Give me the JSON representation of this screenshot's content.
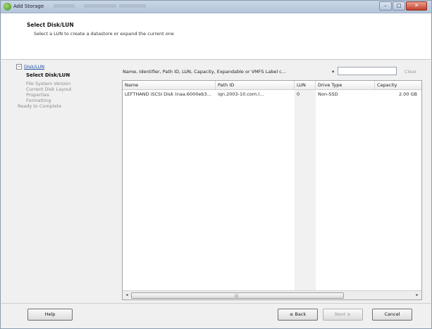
{
  "window": {
    "title": "Add Storage",
    "buttons": {
      "minimize": "–",
      "maximize": "□",
      "close": "✕"
    }
  },
  "header": {
    "title": "Select Disk/LUN",
    "subtitle": "Select a LUN to create a datastore or expand the current one"
  },
  "sidebar": {
    "items": [
      {
        "label": "Disk/LUN",
        "state": "parent"
      },
      {
        "label": "Select Disk/LUN",
        "state": "active"
      },
      {
        "label": "File System Version",
        "state": "pending"
      },
      {
        "label": "Current Disk Layout",
        "state": "pending"
      },
      {
        "label": "Properties",
        "state": "pending"
      },
      {
        "label": "Formatting",
        "state": "pending"
      },
      {
        "label": "Ready to Complete",
        "state": "pending"
      }
    ]
  },
  "filter": {
    "label": "Name, Identifier, Path ID, LUN, Capacity, Expandable or VMFS Label c...",
    "caret": "▾",
    "value": "",
    "clear_label": "Clear"
  },
  "table": {
    "columns": [
      "Name",
      "Path ID",
      "LUN",
      "Drive Type",
      "Capacity"
    ],
    "rows": [
      {
        "name": "LEFTHAND iSCSI Disk (naa.6000eb3...",
        "path_id": "iqn.2003-10.com.l...",
        "lun": "0",
        "drive_type": "Non-SSD",
        "capacity": "2.00 GB"
      }
    ]
  },
  "scrollbar": {
    "left": "◂",
    "right": "▸",
    "grip": "|||"
  },
  "footer": {
    "help": "Help",
    "back": "≤ Back",
    "next": "Next ≥",
    "cancel": "Cancel"
  }
}
